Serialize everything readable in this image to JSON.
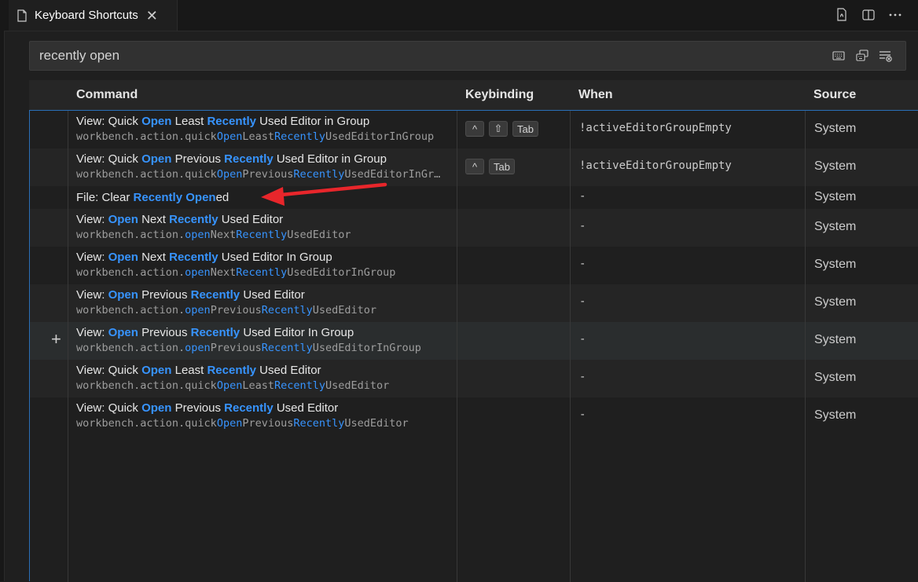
{
  "tab": {
    "title": "Keyboard Shortcuts",
    "file_icon": "file-icon",
    "close": "✕"
  },
  "toolbar_icons": [
    "open-json-icon",
    "split-editor-icon",
    "more-actions-icon"
  ],
  "search": {
    "value": "recently open",
    "actions": [
      "record-keys-icon",
      "sort-by-precedence-icon",
      "clear-filter-icon"
    ]
  },
  "columns": {
    "command": "Command",
    "keybinding": "Keybinding",
    "when": "When",
    "source": "Source"
  },
  "rows": [
    {
      "title": [
        [
          "View: Quick ",
          false
        ],
        [
          "Open",
          true
        ],
        [
          " Least ",
          false
        ],
        [
          "Recently",
          true
        ],
        [
          " Used Editor in Group",
          false
        ]
      ],
      "id": [
        [
          "workbench.action.quick",
          false
        ],
        [
          "Open",
          true
        ],
        [
          "Least",
          false
        ],
        [
          "Recently",
          true
        ],
        [
          "UsedEditorInGroup",
          false
        ]
      ],
      "keys": [
        "^",
        "⇧",
        "Tab"
      ],
      "when": "!activeEditorGroupEmpty",
      "source": "System"
    },
    {
      "title": [
        [
          "View: Quick ",
          false
        ],
        [
          "Open",
          true
        ],
        [
          " Previous ",
          false
        ],
        [
          "Recently",
          true
        ],
        [
          " Used Editor in Group",
          false
        ]
      ],
      "id": [
        [
          "workbench.action.quick",
          false
        ],
        [
          "Open",
          true
        ],
        [
          "Previous",
          false
        ],
        [
          "Recently",
          true
        ],
        [
          "UsedEditorInGr…",
          false
        ]
      ],
      "keys": [
        "^",
        "Tab"
      ],
      "when": "!activeEditorGroupEmpty",
      "source": "System"
    },
    {
      "title": [
        [
          "File: Clear ",
          false
        ],
        [
          "Recently",
          true
        ],
        [
          " ",
          false
        ],
        [
          "Open",
          true
        ],
        [
          "ed",
          false
        ]
      ],
      "id": [],
      "keys": [],
      "when": "-",
      "source": "System"
    },
    {
      "title": [
        [
          "View: ",
          false
        ],
        [
          "Open",
          true
        ],
        [
          " Next ",
          false
        ],
        [
          "Recently",
          true
        ],
        [
          " Used Editor",
          false
        ]
      ],
      "id": [
        [
          "workbench.action.",
          false
        ],
        [
          "open",
          true
        ],
        [
          "Next",
          false
        ],
        [
          "Recently",
          true
        ],
        [
          "UsedEditor",
          false
        ]
      ],
      "keys": [],
      "when": "-",
      "source": "System"
    },
    {
      "title": [
        [
          "View: ",
          false
        ],
        [
          "Open",
          true
        ],
        [
          " Next ",
          false
        ],
        [
          "Recently",
          true
        ],
        [
          " Used Editor In Group",
          false
        ]
      ],
      "id": [
        [
          "workbench.action.",
          false
        ],
        [
          "open",
          true
        ],
        [
          "Next",
          false
        ],
        [
          "Recently",
          true
        ],
        [
          "UsedEditorInGroup",
          false
        ]
      ],
      "keys": [],
      "when": "-",
      "source": "System"
    },
    {
      "title": [
        [
          "View: ",
          false
        ],
        [
          "Open",
          true
        ],
        [
          " Previous ",
          false
        ],
        [
          "Recently",
          true
        ],
        [
          " Used Editor",
          false
        ]
      ],
      "id": [
        [
          "workbench.action.",
          false
        ],
        [
          "open",
          true
        ],
        [
          "Previous",
          false
        ],
        [
          "Recently",
          true
        ],
        [
          "UsedEditor",
          false
        ]
      ],
      "keys": [],
      "when": "-",
      "source": "System"
    },
    {
      "title": [
        [
          "View: ",
          false
        ],
        [
          "Open",
          true
        ],
        [
          " Previous ",
          false
        ],
        [
          "Recently",
          true
        ],
        [
          " Used Editor In Group",
          false
        ]
      ],
      "id": [
        [
          "workbench.action.",
          false
        ],
        [
          "open",
          true
        ],
        [
          "Previous",
          false
        ],
        [
          "Recently",
          true
        ],
        [
          "UsedEditorInGroup",
          false
        ]
      ],
      "keys": [],
      "when": "-",
      "source": "System",
      "hovered": true,
      "add_icon": "+"
    },
    {
      "title": [
        [
          "View: Quick ",
          false
        ],
        [
          "Open",
          true
        ],
        [
          " Least ",
          false
        ],
        [
          "Recently",
          true
        ],
        [
          " Used Editor",
          false
        ]
      ],
      "id": [
        [
          "workbench.action.quick",
          false
        ],
        [
          "Open",
          true
        ],
        [
          "Least",
          false
        ],
        [
          "Recently",
          true
        ],
        [
          "UsedEditor",
          false
        ]
      ],
      "keys": [],
      "when": "-",
      "source": "System"
    },
    {
      "title": [
        [
          "View: Quick ",
          false
        ],
        [
          "Open",
          true
        ],
        [
          " Previous ",
          false
        ],
        [
          "Recently",
          true
        ],
        [
          " Used Editor",
          false
        ]
      ],
      "id": [
        [
          "workbench.action.quick",
          false
        ],
        [
          "Open",
          true
        ],
        [
          "Previous",
          false
        ],
        [
          "Recently",
          true
        ],
        [
          "UsedEditor",
          false
        ]
      ],
      "keys": [],
      "when": "-",
      "source": "System"
    }
  ],
  "annotation": {
    "arrow_color": "#e8262b"
  },
  "colors": {
    "highlight": "#3794ff",
    "focus_border": "#2a6fb8"
  }
}
